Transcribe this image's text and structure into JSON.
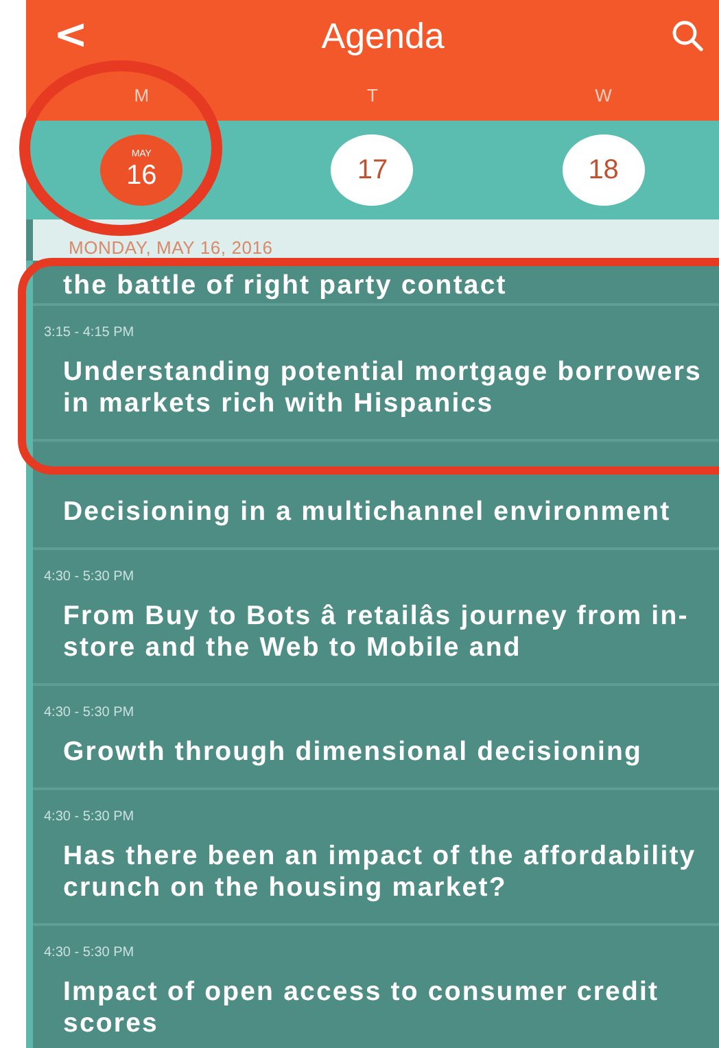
{
  "header": {
    "back": "<",
    "title": "Agenda"
  },
  "days": [
    {
      "letter": "M",
      "month": "MAY",
      "date": "16",
      "selected": true
    },
    {
      "letter": "T",
      "date": "17",
      "selected": false
    },
    {
      "letter": "W",
      "date": "18",
      "selected": false
    }
  ],
  "date_heading": "MONDAY, MAY 16, 2016",
  "sessions": [
    {
      "title": "the battle of right party contact",
      "kind": "partial"
    },
    {
      "time": "3:15 - 4:15 PM",
      "title": "Understanding potential mortgage borrowers in markets rich with Hispanics"
    },
    {
      "title": "Decisioning in a multichannel environment"
    },
    {
      "time": "4:30 - 5:30 PM",
      "title": "From Buy to Bots â retailâs journey from in-store and the Web to Mobile and"
    },
    {
      "time": "4:30 - 5:30 PM",
      "title": "Growth through dimensional decisioning"
    },
    {
      "time": "4:30 - 5:30 PM",
      "title": "Has there been an impact of the affordability crunch on the housing market?"
    },
    {
      "time": "4:30 - 5:30 PM",
      "title": "Impact of open access to consumer credit scores"
    }
  ]
}
